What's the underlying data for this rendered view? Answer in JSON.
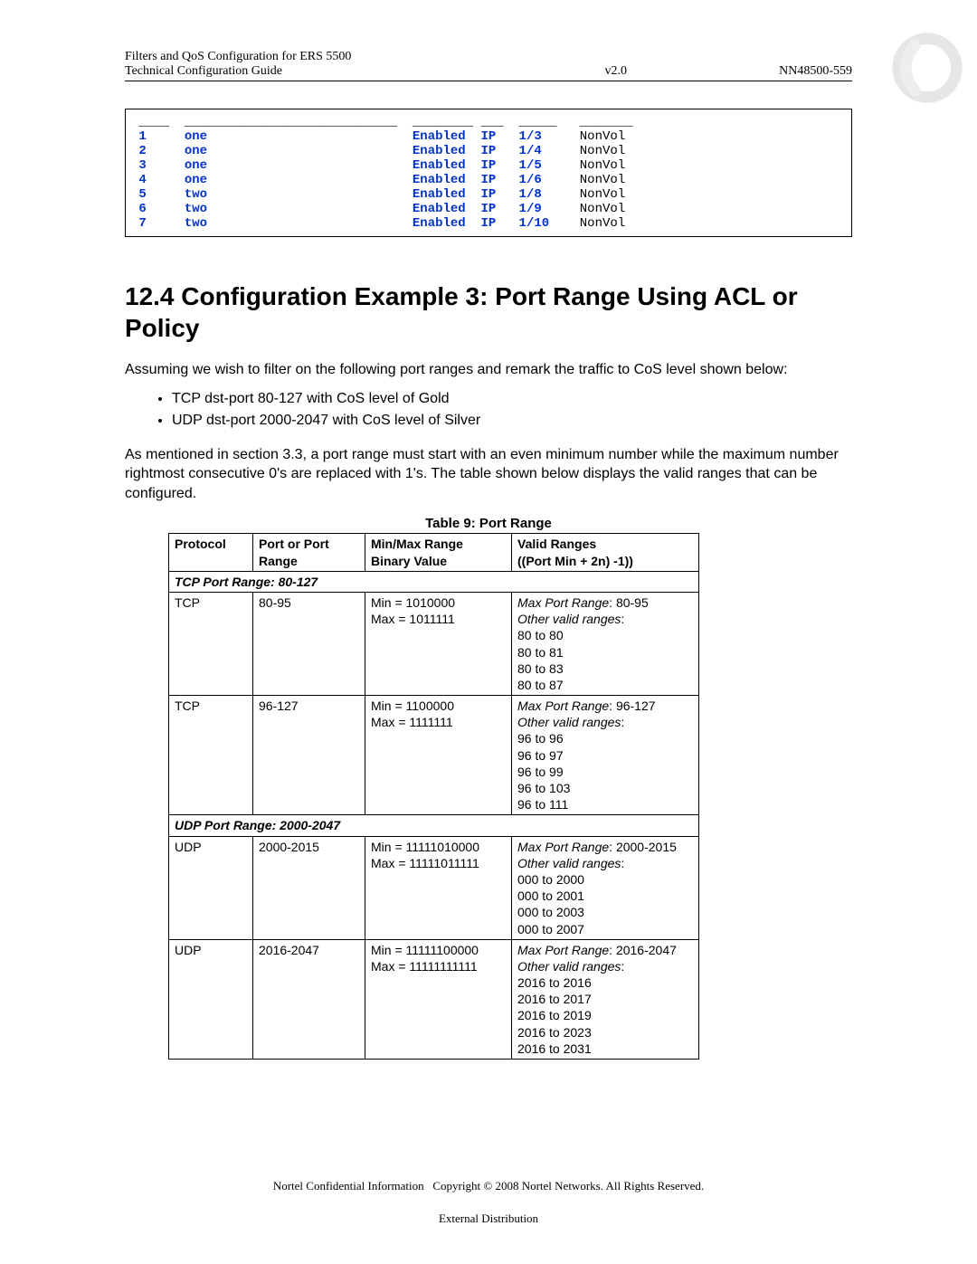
{
  "header": {
    "line1_left": "Filters and QoS Configuration for ERS 5500",
    "line2_left": "Technical Configuration Guide",
    "line2_mid": "v2.0",
    "line2_right": "NN48500-559"
  },
  "term_rows": [
    {
      "num": "1",
      "name": "one",
      "state": "Enabled",
      "type": "IP",
      "port": "1/3",
      "stor": "NonVol"
    },
    {
      "num": "2",
      "name": "one",
      "state": "Enabled",
      "type": "IP",
      "port": "1/4",
      "stor": "NonVol"
    },
    {
      "num": "3",
      "name": "one",
      "state": "Enabled",
      "type": "IP",
      "port": "1/5",
      "stor": "NonVol"
    },
    {
      "num": "4",
      "name": "one",
      "state": "Enabled",
      "type": "IP",
      "port": "1/6",
      "stor": "NonVol"
    },
    {
      "num": "5",
      "name": "two",
      "state": "Enabled",
      "type": "IP",
      "port": "1/8",
      "stor": "NonVol"
    },
    {
      "num": "6",
      "name": "two",
      "state": "Enabled",
      "type": "IP",
      "port": "1/9",
      "stor": "NonVol"
    },
    {
      "num": "7",
      "name": "two",
      "state": "Enabled",
      "type": "IP",
      "port": "1/10",
      "stor": "NonVol"
    }
  ],
  "section_title": "12.4 Configuration Example 3: Port Range Using ACL or Policy",
  "intro_text": "Assuming we wish to filter on the following port ranges and remark the traffic to CoS level shown below:",
  "bullets": [
    "TCP dst-port 80-127 with CoS level of Gold",
    "UDP dst-port 2000-2047 with CoS level of Silver"
  ],
  "post_bullets": "As mentioned in section 3.3, a port range must start with an even minimum number while the maximum number rightmost consecutive 0's are replaced with 1's. The table shown below displays the valid ranges that can be configured.",
  "table_caption": "Table 9: Port Range",
  "table": {
    "headers": {
      "protocol": "Protocol",
      "port_range": "Port or Port Range",
      "binary_l1": "Min/Max Range",
      "binary_l2": "Binary Value",
      "valid_l1": "Valid Ranges",
      "valid_l2": "((Port Min + 2n) -1))"
    },
    "sections": [
      {
        "header": "TCP Port Range: 80-127",
        "rows": [
          {
            "protocol": "TCP",
            "range": "80-95",
            "bin_min": "Min = 1010000",
            "bin_max": "Max = 1011111",
            "valid_head": "Max Port Range: 80-95",
            "other_head": "Other valid ranges:",
            "others": [
              "80 to 80",
              "80 to 81",
              "80 to 83",
              "80 to 87"
            ]
          },
          {
            "protocol": "TCP",
            "range": "96-127",
            "bin_min": "Min = 1100000",
            "bin_max": "Max = 1111111",
            "valid_head": "Max Port Range: 96-127",
            "other_head": "Other valid ranges:",
            "others": [
              "96 to 96",
              "96 to 97",
              "96 to 99",
              "96 to 103",
              "96 to 111"
            ]
          }
        ]
      },
      {
        "header": "UDP Port Range: 2000-2047",
        "rows": [
          {
            "protocol": "UDP",
            "range": "2000-2015",
            "bin_min": "Min = 11111010000",
            "bin_max": "Max = 11111011111",
            "valid_head": "Max Port Range: 2000-2015",
            "other_head": "Other valid ranges:",
            "others": [
              "000 to 2000",
              "000 to 2001",
              "000 to 2003",
              "000 to 2007"
            ]
          },
          {
            "protocol": "UDP",
            "range": "2016-2047",
            "bin_min": "Min = 11111100000",
            "bin_max": "Max = 11111111111",
            "valid_head": "Max Port Range: 2016-2047",
            "other_head": "Other valid ranges:",
            "others": [
              "2016 to 2016",
              "2016 to 2017",
              "2016 to 2019",
              "2016 to 2023",
              "2016 to 2031"
            ]
          }
        ]
      }
    ]
  },
  "footer": {
    "line1": "Nortel Confidential Information   Copyright © 2008 Nortel Networks. All Rights Reserved.",
    "line2": "External Distribution"
  }
}
